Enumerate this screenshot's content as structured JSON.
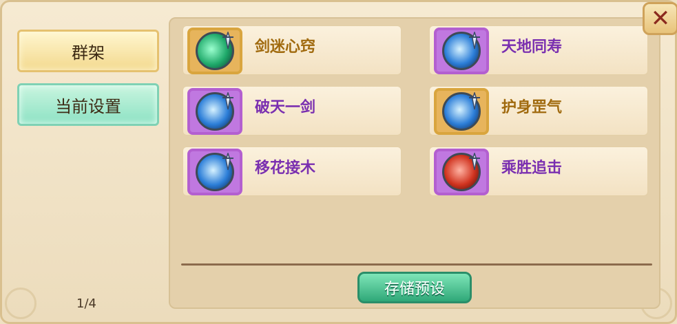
{
  "left_panel": {
    "tabs": [
      {
        "label": "群架"
      },
      {
        "label": "当前设置"
      }
    ],
    "page_indicator": "1/4"
  },
  "skills": [
    {
      "name": "剑迷心窍",
      "frame": "gold",
      "icon": "green-swirl-skill-icon",
      "name_color": "#a06a0e"
    },
    {
      "name": "天地同寿",
      "frame": "purple",
      "icon": "blue-slash-skill-icon",
      "name_color": "#7a2fb0"
    },
    {
      "name": "破天一剑",
      "frame": "purple",
      "icon": "blue-burst-skill-icon",
      "name_color": "#7a2fb0"
    },
    {
      "name": "护身罡气",
      "frame": "gold",
      "icon": "blue-guard-skill-icon",
      "name_color": "#a06a0e"
    },
    {
      "name": "移花接木",
      "frame": "purple",
      "icon": "blue-swirl-skill-icon",
      "name_color": "#7a2fb0"
    },
    {
      "name": "乘胜追击",
      "frame": "purple",
      "icon": "red-broken-heart-skill-icon",
      "name_color": "#7a2fb0"
    }
  ],
  "save_button": {
    "label": "存储预设"
  },
  "close_button": {
    "icon": "close-icon"
  }
}
